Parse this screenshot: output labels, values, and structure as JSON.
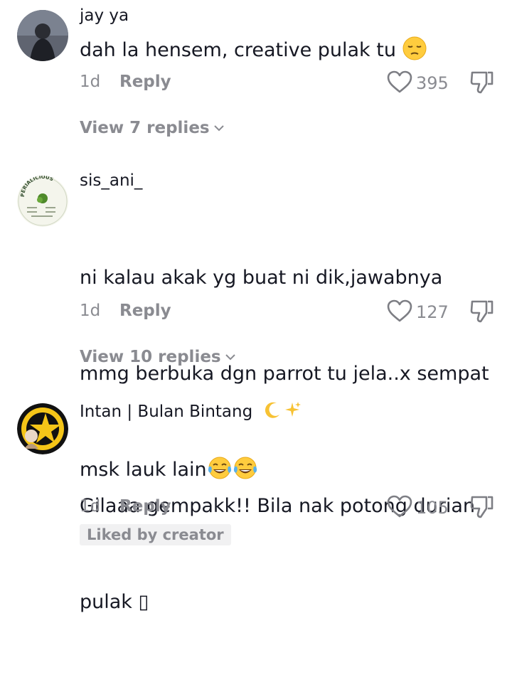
{
  "comments": [
    {
      "username": "jay ya",
      "text": "dah la hensem, creative pulak tu ",
      "emoji": "pensive-face",
      "time": "1d",
      "reply_label": "Reply",
      "likes": "395",
      "view_replies": "View 7 replies"
    },
    {
      "username": "sis_ani_",
      "avatar_text": "PERIALICIOUS",
      "text_lines": [
        "ni kalau akak yg buat ni dik,jawabnya",
        "mmg berbuka dgn parrot tu jela..x sempat",
        "msk lauk lain"
      ],
      "emoji": "tears-of-joy",
      "time": "1d",
      "reply_label": "Reply",
      "likes": "127",
      "view_replies": "View 10 replies"
    },
    {
      "username": "Intan | Bulan Bintang",
      "username_emoji": "crescent-moon sparkles",
      "text_lines": [
        "Gilaaa gempakk!! Bila nak potong durian",
        "pulak ▯"
      ],
      "time": "1d",
      "reply_label": "Reply",
      "likes": "105",
      "badge": "Liked by creator"
    }
  ],
  "colors": {
    "text": "#161823",
    "muted": "#8a8b91",
    "badge_bg": "#f1f1f2"
  }
}
